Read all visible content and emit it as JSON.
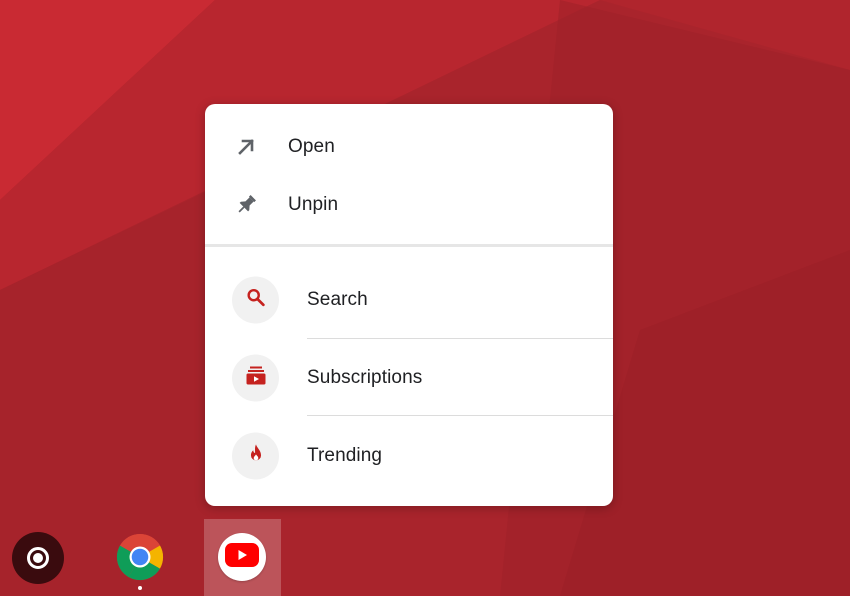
{
  "colors": {
    "wallpaper_base": "#a9242c",
    "accent_red": "#c5221f",
    "icon_gray": "#5f6368",
    "youtube_red": "#ff0000"
  },
  "context_menu": {
    "items": [
      {
        "label": "Open",
        "icon": "arrow-up-right-icon"
      },
      {
        "label": "Unpin",
        "icon": "pin-icon"
      }
    ],
    "shortcuts": [
      {
        "label": "Search",
        "icon": "search-icon"
      },
      {
        "label": "Subscriptions",
        "icon": "subscriptions-icon"
      },
      {
        "label": "Trending",
        "icon": "flame-icon"
      }
    ]
  },
  "shelf": {
    "apps": [
      {
        "name": "launcher",
        "icon": "launcher-icon"
      },
      {
        "name": "chrome",
        "icon": "chrome-icon",
        "running": true
      },
      {
        "name": "youtube",
        "icon": "youtube-icon",
        "selected": true
      }
    ]
  }
}
